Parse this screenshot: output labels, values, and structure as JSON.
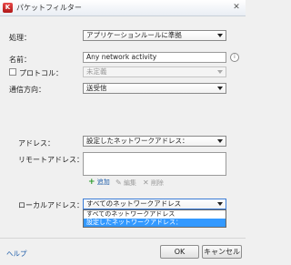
{
  "window": {
    "title": "パケットフィルター",
    "close_glyph": "✕"
  },
  "form": {
    "action": {
      "label": "処理：",
      "value": "アプリケーションルールに準拠"
    },
    "name": {
      "label": "名前：",
      "value": "Any network activity",
      "info_glyph": "i"
    },
    "protocol": {
      "label": "プロトコル：",
      "value": "未定義",
      "checked": false
    },
    "direction": {
      "label": "通信方向：",
      "value": "送受信"
    },
    "address": {
      "label": "アドレス：",
      "value": "設定したネットワークアドレス："
    },
    "remote_address": {
      "label": "リモートアドレス："
    },
    "toolbar": {
      "add_icon": "+",
      "add_label": "追加",
      "edit_icon": "✎",
      "edit_label": "編集",
      "delete_icon": "✕",
      "delete_label": "削除"
    },
    "local_address": {
      "label": "ローカルアドレス：",
      "value": "すべてのネットワークアドレス",
      "options": [
        "すべてのネットワークアドレス",
        "設定したネットワークアドレス："
      ],
      "highlighted_index": 1
    }
  },
  "footer": {
    "help_label": "ヘルプ",
    "ok_label": "OK",
    "cancel_label": "キャンセル"
  }
}
